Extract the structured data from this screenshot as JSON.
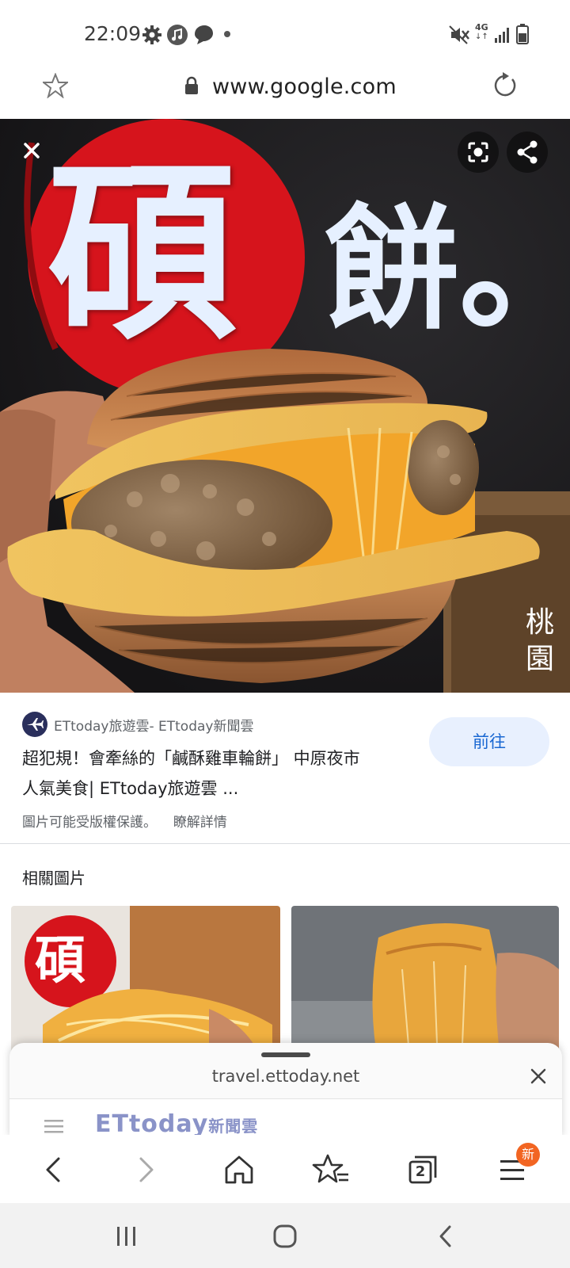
{
  "status_bar": {
    "time": "22:09",
    "left_icons": [
      "gear-icon",
      "music-icon",
      "chat-icon",
      "dot-icon"
    ],
    "right_icons": [
      "mute-icon",
      "4g-icon",
      "signal-icon",
      "battery-icon"
    ],
    "network_label": "4G"
  },
  "url_bar": {
    "url": "www.google.com"
  },
  "hero": {
    "overlay_chars": [
      "碩",
      "餅。"
    ],
    "location_text": [
      "桃",
      "園"
    ]
  },
  "source": {
    "site_name": "ETtoday旅遊雲- ETtoday新聞雲",
    "title_line1": "超犯規！會牽絲的「鹹酥雞車輪餅」 中原夜市",
    "title_line2": "人氣美食| ETtoday旅遊雲 ...",
    "visit_label": "前往",
    "copyright_notice": "圖片可能受版權保護。",
    "learn_more": "瞭解詳情"
  },
  "related": {
    "heading": "相關圖片",
    "thumb1_char": "碩"
  },
  "sheet": {
    "url": "travel.ettoday.net",
    "preview_logo": "ETtoday",
    "preview_logo_suffix": "新聞雲"
  },
  "toolbar": {
    "badge": "新",
    "tab_count": "2"
  },
  "colors": {
    "accent_blue": "#1967d2",
    "visit_bg": "#e8f0fe",
    "badge_orange": "#f26522",
    "logo_red": "#d6141c"
  }
}
